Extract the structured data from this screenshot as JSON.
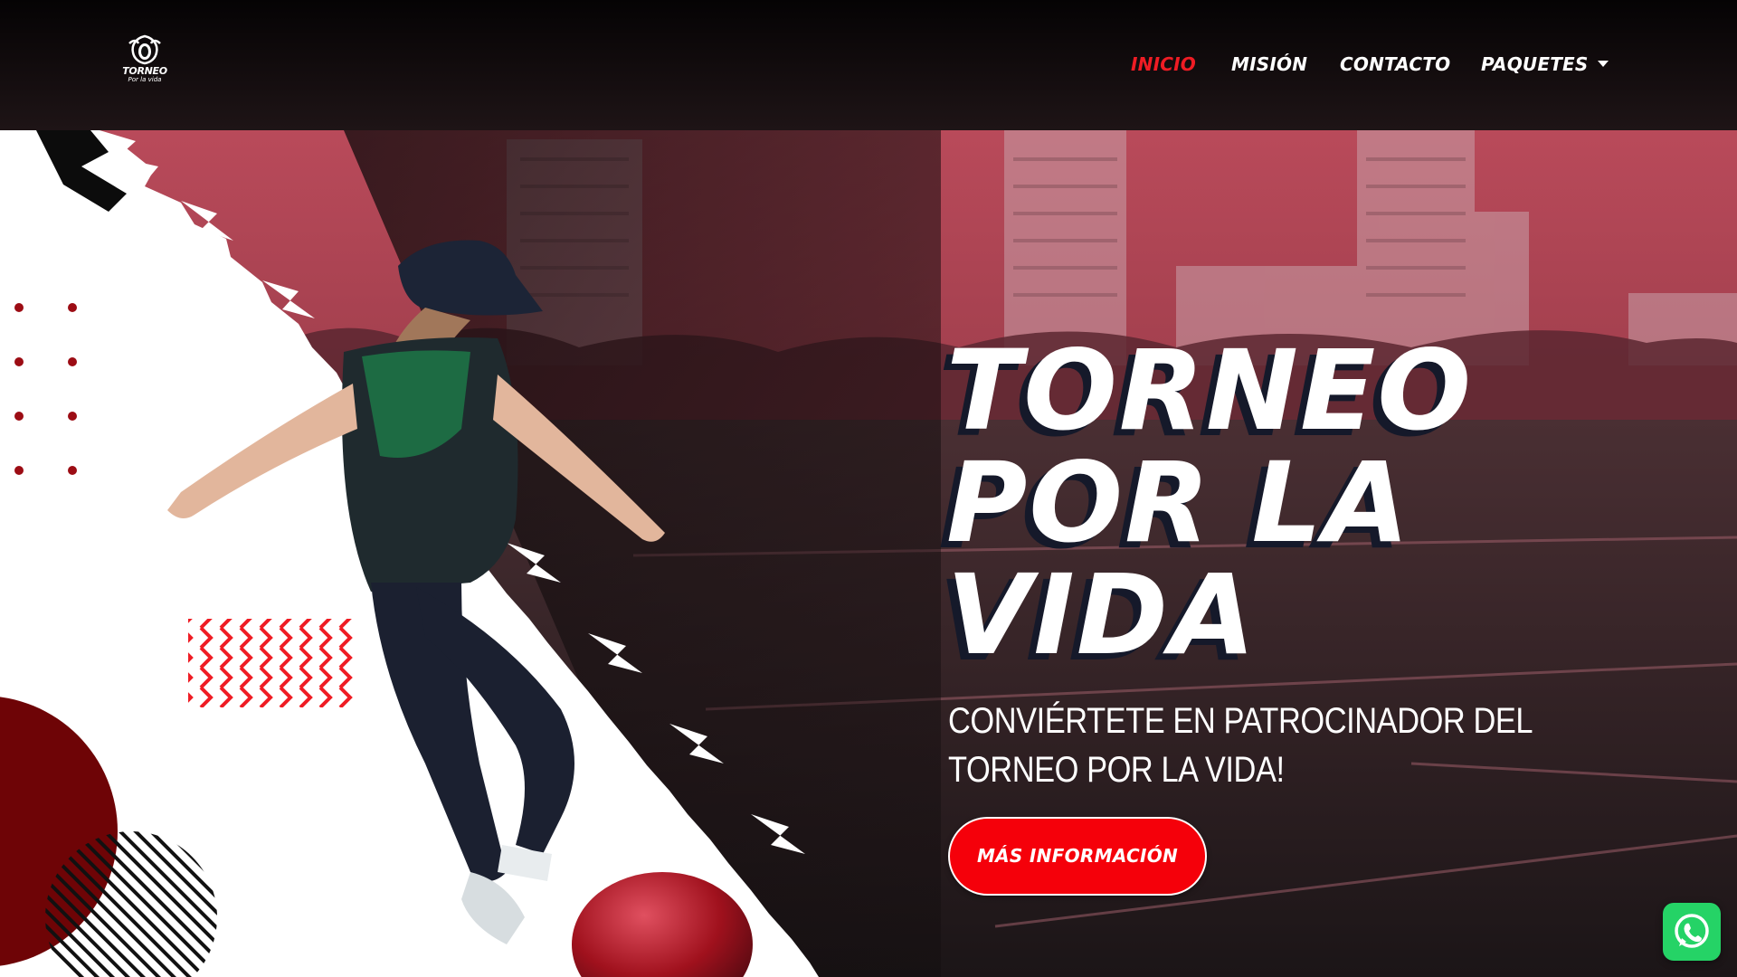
{
  "logo": {
    "title": "TORNEO",
    "subtitle": "Por la vida"
  },
  "nav": {
    "items": [
      {
        "label": "INICIO",
        "active": true
      },
      {
        "label": "MISIÓN",
        "active": false
      },
      {
        "label": "CONTACTO",
        "active": false
      },
      {
        "label": "PAQUETES",
        "active": false,
        "has_dropdown": true
      }
    ]
  },
  "hero": {
    "title_lines": [
      "TORNEO",
      "POR LA",
      "VIDA"
    ],
    "subtitle": "CONVIÉRTETE EN PATROCINADOR DEL TORNEO POR LA VIDA!",
    "cta_label": "MÁS INFORMACIÓN"
  },
  "whatsapp": {
    "icon": "whatsapp-icon"
  },
  "colors": {
    "accent_red": "#ef1c24",
    "cta_red": "#f5000a",
    "header_dark": "#0a0607",
    "overlay_red": "#b34757",
    "whatsapp_green": "#25d366"
  }
}
